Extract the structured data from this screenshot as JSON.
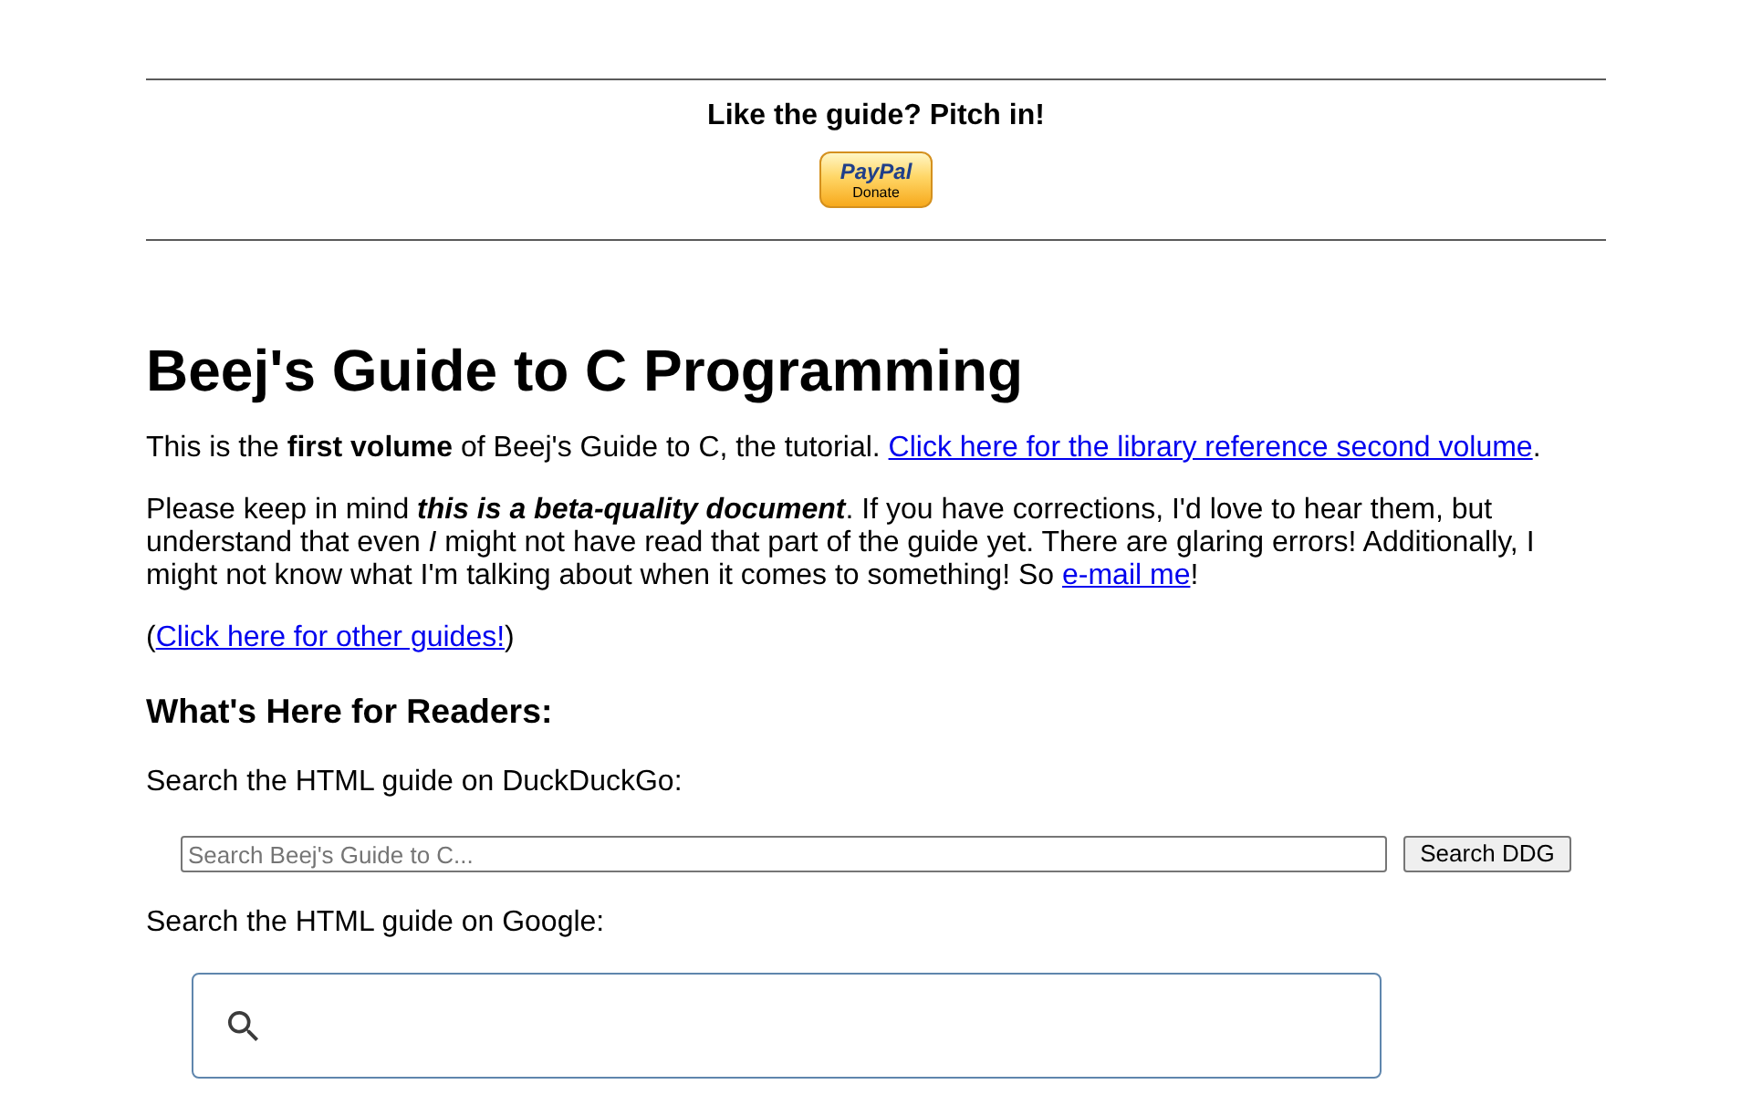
{
  "donate_banner": {
    "heading": "Like the guide? Pitch in!",
    "button": {
      "brand": "PayPal",
      "label": "Donate"
    }
  },
  "title": "Beej's Guide to C Programming",
  "paragraphs": [
    {
      "parts": [
        {
          "kind": "text",
          "text": "This is the **first volume** of Beej's Guide to C, the tutorial. "
        },
        {
          "kind": "link",
          "text": "Click here for the library reference second volume"
        },
        {
          "kind": "text",
          "text": "."
        }
      ]
    },
    {
      "parts": [
        {
          "kind": "text",
          "text": "Please keep in mind "
        },
        {
          "kind": "strong_emphasis",
          "text": "this is a beta-quality document"
        },
        {
          "kind": "text",
          "text": ". If you have corrections, I'd love to hear them, but understand that even *I* might not have read that part of the guide yet. There are glaring errors! Additionally, I might not know what I'm talking about when it comes to something! So "
        },
        {
          "kind": "link",
          "text": "e-mail me"
        },
        {
          "kind": "text",
          "text": "!"
        }
      ]
    },
    {
      "parts": [
        {
          "kind": "text",
          "text": "("
        },
        {
          "kind": "link",
          "text": "Click here for other guides!"
        },
        {
          "kind": "text",
          "text": ")"
        }
      ]
    }
  ],
  "readers_section": {
    "heading": "What's Here for Readers:",
    "ddg_search": {
      "label": "Search the HTML guide on DuckDuckGo:",
      "placeholder": "Search Beej's Guide to C...",
      "button": "Search DDG"
    },
    "google_search": {
      "label": "Search the HTML guide on Google:"
    }
  }
}
